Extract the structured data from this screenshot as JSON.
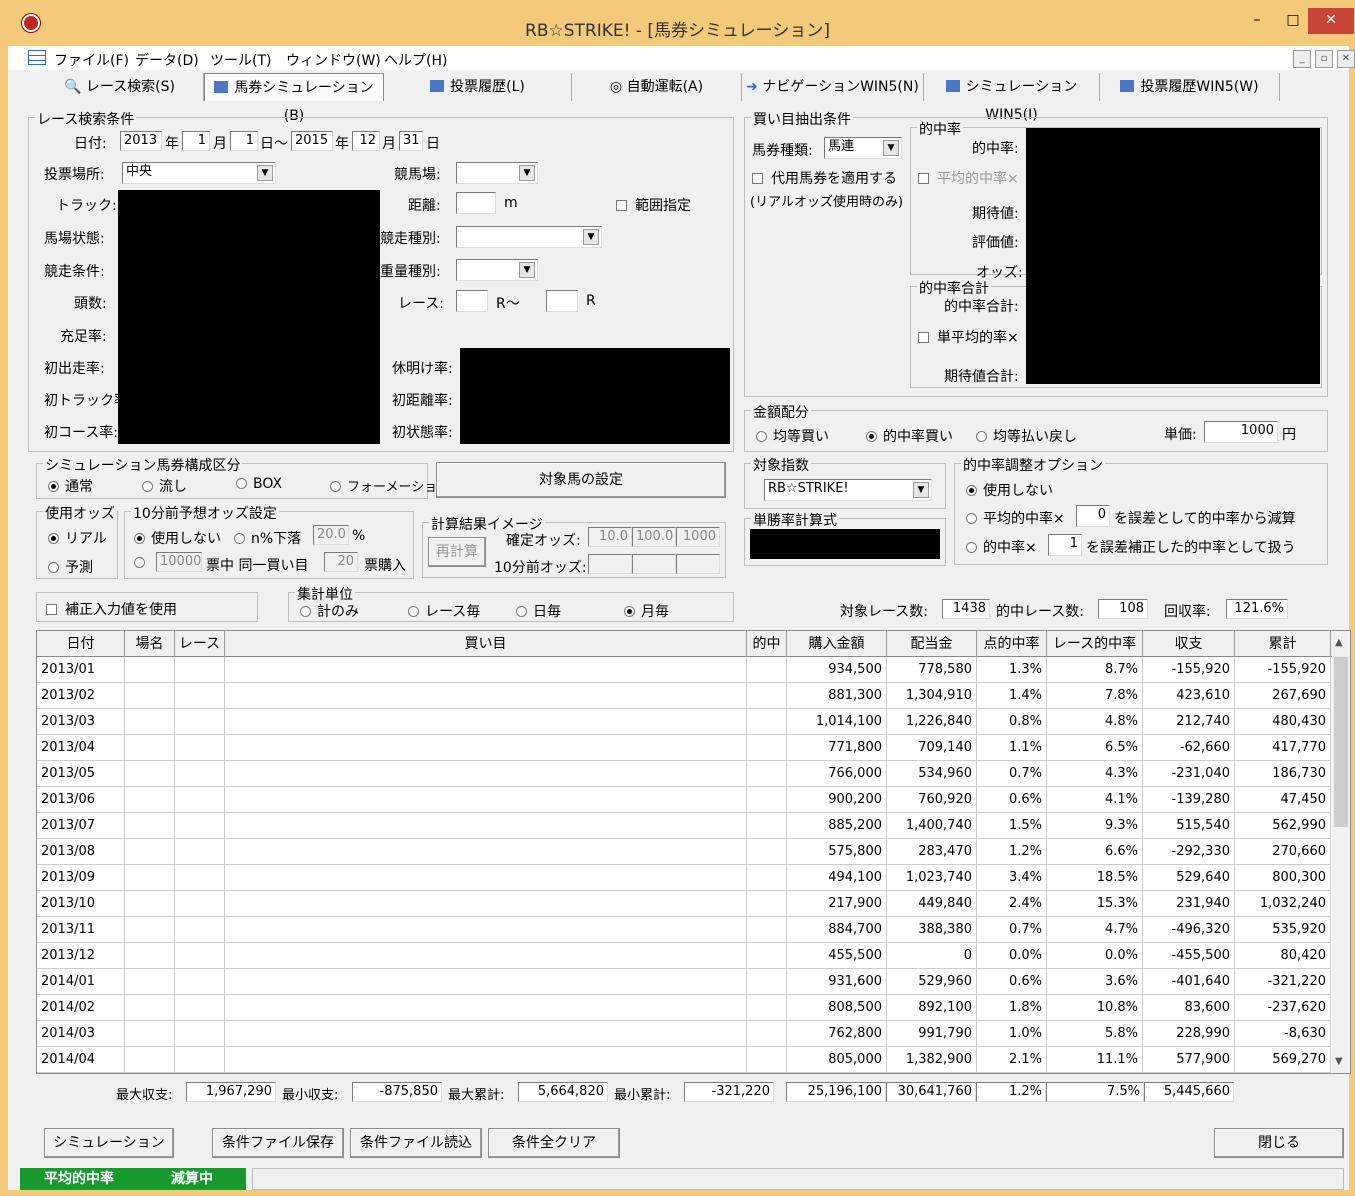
{
  "window": {
    "title": "RB☆STRIKE! - [馬券シミュレーション]",
    "minimize": "–",
    "maximize": "□",
    "close": "✕"
  },
  "menu": [
    {
      "label": "ファイル(F)"
    },
    {
      "label": "データ(D)"
    },
    {
      "label": "ツール(T)"
    },
    {
      "label": "ウィンドウ(W)"
    },
    {
      "label": "ヘルプ(H)"
    }
  ],
  "mdi": {
    "min": "_",
    "restore": "▫",
    "close": "✕"
  },
  "tabs": [
    {
      "label": "レース検索(S)"
    },
    {
      "label": "馬券シミュレーション(B)"
    },
    {
      "label": "投票履歴(L)"
    },
    {
      "label": "自動運転(A)"
    },
    {
      "label": "ナビゲーションWIN5(N)"
    },
    {
      "label": "シミュレーションWIN5(I)"
    },
    {
      "label": "投票履歴WIN5(W)"
    }
  ],
  "race": {
    "title": "レース検索条件",
    "date_label": "日付:",
    "year1": "2013",
    "year_unit": "年",
    "month1": "1",
    "month_unit": "月",
    "day1": "1",
    "day_unit_range": "日〜",
    "year2": "2015",
    "month2": "12",
    "day2": "31",
    "day_unit": "日",
    "venue_label": "投票場所:",
    "venue": "中央",
    "course_label": "競馬場:",
    "track_label": "トラック:",
    "distance_label": "距離:",
    "distance_unit": "m",
    "range_label": "範囲指定",
    "condition_label": "馬場状態:",
    "race_type_label": "競走種別:",
    "race_cond_label": "競走条件:",
    "weight_label": "重量種別:",
    "heads_label": "頭数:",
    "races_label": "レース:",
    "r_from": "R〜",
    "r_to": "R",
    "fill_label": "充足率:",
    "first_run_label": "初出走率:",
    "rest_label": "休明け率:",
    "first_track_label": "初トラック率:",
    "first_dist_label": "初距離率:",
    "first_course_label": "初コース率:",
    "first_state_label": "初状態率:"
  },
  "buy": {
    "title": "買い目抽出条件",
    "ticket_label": "馬券種類:",
    "ticket": "馬連",
    "substitute": "代用馬券を適用する",
    "real_only": "(リアルオッズ使用時のみ)",
    "hit_title": "的中率",
    "hit_label": "的中率:",
    "avg_hit": "平均的中率×",
    "expect_label": "期待値:",
    "eval_label": "評価値:",
    "odds_label": "オッズ:",
    "hit_sum_title": "的中率合計",
    "hit_sum_label": "的中率合計:",
    "single_avg": "単平均的率×",
    "expect_sum_label": "期待値合計:"
  },
  "money": {
    "title": "金額配分",
    "opt1": "均等買い",
    "opt2": "的中率買い",
    "opt3": "均等払い戻し",
    "unit_label": "単価:",
    "unit_value": "1000",
    "yen": "円"
  },
  "sim": {
    "title": "シミュレーション馬券構成区分",
    "opt1": "通常",
    "opt2": "流し",
    "opt3": "BOX",
    "opt4": "フォーメーション",
    "target_btn": "対象馬の設定"
  },
  "index": {
    "title": "対象指数",
    "value": "RB☆STRIKE!",
    "formula_title": "単勝率計算式"
  },
  "adjust": {
    "title": "的中率調整オプション",
    "opt1": "使用しない",
    "opt2a": "平均的中率×",
    "v2": "0",
    "opt2b": "を誤差として的中率から減算",
    "opt3a": "的中率×",
    "v3": "1",
    "opt3b": "を誤差補正した的中率として扱う"
  },
  "odds": {
    "title": "使用オッズ",
    "real": "リアル",
    "pred": "予測"
  },
  "pre": {
    "title": "10分前予想オッズ設定",
    "opt1": "使用しない",
    "opt2": "n%下落",
    "pct": "20.0",
    "pct_unit": "%",
    "count": "10000",
    "mid": "票中 同一買い目",
    "buy_count": "20",
    "end": "票購入"
  },
  "calc": {
    "title": "計算結果イメージ",
    "recalc": "再計算",
    "fixed_label": "確定オッズ:",
    "v1": "10.0",
    "v2": "100.0",
    "v3": "1000",
    "pre_label": "10分前オッズ:"
  },
  "correction": "補正入力値を使用",
  "agg": {
    "title": "集計単位",
    "opt1": "計のみ",
    "opt2": "レース毎",
    "opt3": "日毎",
    "opt4": "月毎"
  },
  "summary": {
    "races_label": "対象レース数:",
    "races": "1438",
    "hits_label": "的中レース数:",
    "hits": "108",
    "return_label": "回収率:",
    "return": "121.6%"
  },
  "columns": [
    "日付",
    "場名",
    "レース",
    "買い目",
    "的中",
    "購入金額",
    "配当金",
    "点的中率",
    "レース的中率",
    "収支",
    "累計"
  ],
  "rows": [
    [
      "2013/01",
      "",
      "",
      "",
      "",
      "934,500",
      "778,580",
      "1.3%",
      "8.7%",
      "-155,920",
      "-155,920"
    ],
    [
      "2013/02",
      "",
      "",
      "",
      "",
      "881,300",
      "1,304,910",
      "1.4%",
      "7.8%",
      "423,610",
      "267,690"
    ],
    [
      "2013/03",
      "",
      "",
      "",
      "",
      "1,014,100",
      "1,226,840",
      "0.8%",
      "4.8%",
      "212,740",
      "480,430"
    ],
    [
      "2013/04",
      "",
      "",
      "",
      "",
      "771,800",
      "709,140",
      "1.1%",
      "6.5%",
      "-62,660",
      "417,770"
    ],
    [
      "2013/05",
      "",
      "",
      "",
      "",
      "766,000",
      "534,960",
      "0.7%",
      "4.3%",
      "-231,040",
      "186,730"
    ],
    [
      "2013/06",
      "",
      "",
      "",
      "",
      "900,200",
      "760,920",
      "0.6%",
      "4.1%",
      "-139,280",
      "47,450"
    ],
    [
      "2013/07",
      "",
      "",
      "",
      "",
      "885,200",
      "1,400,740",
      "1.5%",
      "9.3%",
      "515,540",
      "562,990"
    ],
    [
      "2013/08",
      "",
      "",
      "",
      "",
      "575,800",
      "283,470",
      "1.2%",
      "6.6%",
      "-292,330",
      "270,660"
    ],
    [
      "2013/09",
      "",
      "",
      "",
      "",
      "494,100",
      "1,023,740",
      "3.4%",
      "18.5%",
      "529,640",
      "800,300"
    ],
    [
      "2013/10",
      "",
      "",
      "",
      "",
      "217,900",
      "449,840",
      "2.4%",
      "15.3%",
      "231,940",
      "1,032,240"
    ],
    [
      "2013/11",
      "",
      "",
      "",
      "",
      "884,700",
      "388,380",
      "0.7%",
      "4.7%",
      "-496,320",
      "535,920"
    ],
    [
      "2013/12",
      "",
      "",
      "",
      "",
      "455,500",
      "0",
      "0.0%",
      "0.0%",
      "-455,500",
      "80,420"
    ],
    [
      "2014/01",
      "",
      "",
      "",
      "",
      "931,600",
      "529,960",
      "0.6%",
      "3.6%",
      "-401,640",
      "-321,220"
    ],
    [
      "2014/02",
      "",
      "",
      "",
      "",
      "808,500",
      "892,100",
      "1.8%",
      "10.8%",
      "83,600",
      "-237,620"
    ],
    [
      "2014/03",
      "",
      "",
      "",
      "",
      "762,800",
      "991,790",
      "1.0%",
      "5.8%",
      "228,990",
      "-8,630"
    ],
    [
      "2014/04",
      "",
      "",
      "",
      "",
      "805,000",
      "1,382,900",
      "2.1%",
      "11.1%",
      "577,900",
      "569,270"
    ]
  ],
  "footer": {
    "max_label": "最大収支:",
    "max": "1,967,290",
    "min_label": "最小収支:",
    "min": "-875,850",
    "maxsum_label": "最大累計:",
    "maxsum": "5,664,820",
    "minsum_label": "最小累計:",
    "minsum": "-321,220",
    "buy": "25,196,100",
    "pay": "30,641,760",
    "hit": "1.2%",
    "race_hit": "7.5%",
    "balance": "5,445,660"
  },
  "buttons": {
    "simulate": "シミュレーション",
    "save": "条件ファイル保存",
    "load": "条件ファイル読込",
    "clear": "条件全クリア",
    "close": "閉じる"
  },
  "status": {
    "s1": "平均的中率",
    "s2": "減算中"
  },
  "scroll": {
    "up": "▲",
    "down": "▼"
  },
  "colors": {
    "title_bg": "#f3c97a",
    "close_btn": "#c7463a",
    "status_green": "#179b2f"
  }
}
